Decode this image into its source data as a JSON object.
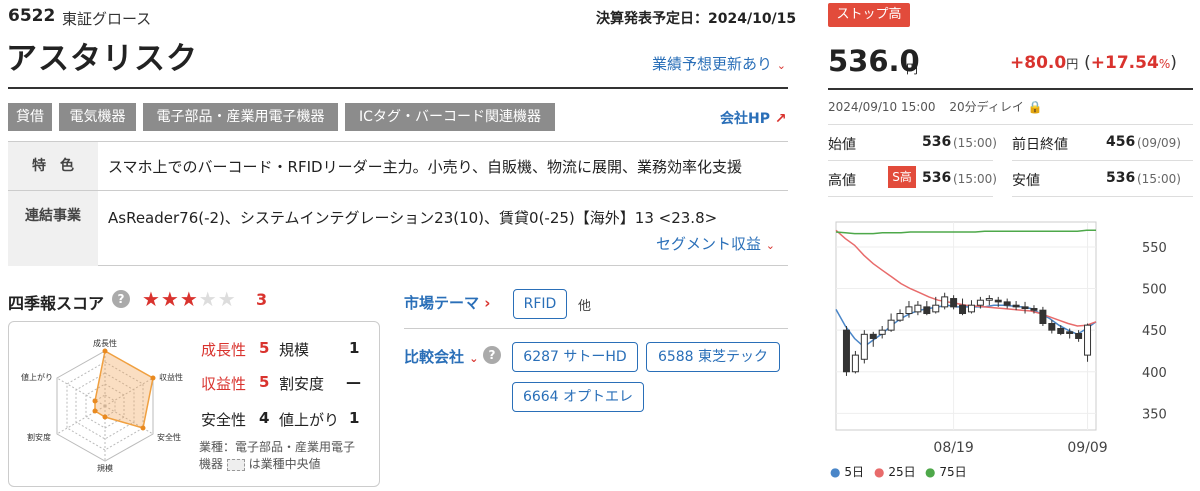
{
  "header": {
    "code": "6522",
    "market": "東証グロース",
    "earnings_date": "決算発表予定日：2024/10/15",
    "name": "アスタリスク",
    "forecast_link": "業績予想更新あり"
  },
  "tags": [
    "貸借",
    "電気機器",
    "電子部品・産業用電子機器",
    "ICタグ・バーコード関連機器"
  ],
  "company_hp": "会社HP",
  "features": {
    "label": "特　色",
    "text": "スマホ上でのバーコード・RFIDリーダー主力。小売り、自販機、物流に展開、業務効率化支援"
  },
  "segments": {
    "label": "連結事業",
    "text": "AsReader76(-2)、システムインテグレーション23(10)、賃貸0(-25)【海外】13 <23.8>",
    "link": "セグメント収益"
  },
  "score": {
    "title": "四季報スコア",
    "help": "?",
    "stars_filled": "★★★",
    "stars_empty": "★★",
    "value": "3",
    "radar_labels": {
      "growth": "成長性",
      "profit": "収益性",
      "safety": "安全性",
      "scale": "規模",
      "cheap": "割安度",
      "rise": "値上がり"
    },
    "items": [
      {
        "label": "成長性",
        "value": "5"
      },
      {
        "label": "規模",
        "value": "1"
      },
      {
        "label": "収益性",
        "value": "5"
      },
      {
        "label": "割安度",
        "value": "—"
      },
      {
        "label": "安全性",
        "value": "4"
      },
      {
        "label": "値上がり",
        "value": "1"
      }
    ],
    "note_line1": "業種：電子部品・産業用電子",
    "note_line2": "機器",
    "note_line3": "は業種中央値"
  },
  "market_theme": {
    "label": "市場テーマ",
    "chip": "RFID",
    "other": "他"
  },
  "compare": {
    "label": "比較会社",
    "help": "?",
    "companies": [
      "6287 サトーHD",
      "6588 東芝テック",
      "6664 オプトエレ"
    ]
  },
  "quote": {
    "badge": "ストップ高",
    "price": "536.0",
    "yen": "円",
    "change": "+80.0",
    "change_unit": "円",
    "change_pct": "+17.54",
    "pct_unit": "%",
    "datetime": "2024/09/10 15:00",
    "delay": "20分ディレイ",
    "open_label": "始値",
    "open": "536",
    "open_time": "(15:00)",
    "prev_label": "前日終値",
    "prev": "456",
    "prev_time": "(09/09)",
    "high_label": "高値",
    "high_badge": "S高",
    "high": "536",
    "high_time": "(15:00)",
    "low_label": "安値",
    "low": "536",
    "low_time": "(15:00)"
  },
  "chart_data": {
    "type": "line",
    "x_ticks": [
      "08/19",
      "09/09"
    ],
    "y_ticks": [
      350,
      400,
      450,
      500,
      550
    ],
    "ylim": [
      330,
      580
    ],
    "candles": [
      {
        "o": 450,
        "c": 400,
        "h": 455,
        "l": 395
      },
      {
        "o": 400,
        "c": 420,
        "h": 425,
        "l": 398
      },
      {
        "o": 415,
        "c": 445,
        "h": 450,
        "l": 410
      },
      {
        "o": 445,
        "c": 440,
        "h": 448,
        "l": 430
      },
      {
        "o": 445,
        "c": 450,
        "h": 455,
        "l": 440
      },
      {
        "o": 450,
        "c": 462,
        "h": 470,
        "l": 448
      },
      {
        "o": 462,
        "c": 470,
        "h": 475,
        "l": 460
      },
      {
        "o": 470,
        "c": 478,
        "h": 485,
        "l": 465
      },
      {
        "o": 472,
        "c": 480,
        "h": 485,
        "l": 468
      },
      {
        "o": 478,
        "c": 470,
        "h": 485,
        "l": 468
      },
      {
        "o": 472,
        "c": 480,
        "h": 490,
        "l": 470
      },
      {
        "o": 478,
        "c": 490,
        "h": 495,
        "l": 475
      },
      {
        "o": 488,
        "c": 478,
        "h": 492,
        "l": 475
      },
      {
        "o": 480,
        "c": 470,
        "h": 488,
        "l": 468
      },
      {
        "o": 472,
        "c": 480,
        "h": 486,
        "l": 470
      },
      {
        "o": 480,
        "c": 486,
        "h": 490,
        "l": 476
      },
      {
        "o": 486,
        "c": 488,
        "h": 492,
        "l": 480
      },
      {
        "o": 486,
        "c": 484,
        "h": 490,
        "l": 478
      },
      {
        "o": 484,
        "c": 480,
        "h": 488,
        "l": 476
      },
      {
        "o": 480,
        "c": 478,
        "h": 485,
        "l": 474
      },
      {
        "o": 478,
        "c": 476,
        "h": 484,
        "l": 470
      },
      {
        "o": 476,
        "c": 474,
        "h": 480,
        "l": 470
      },
      {
        "o": 474,
        "c": 458,
        "h": 478,
        "l": 455
      },
      {
        "o": 458,
        "c": 450,
        "h": 462,
        "l": 446
      },
      {
        "o": 452,
        "c": 446,
        "h": 456,
        "l": 444
      },
      {
        "o": 448,
        "c": 446,
        "h": 452,
        "l": 440
      },
      {
        "o": 446,
        "c": 440,
        "h": 450,
        "l": 436
      },
      {
        "o": 420,
        "c": 456,
        "h": 458,
        "l": 412
      }
    ],
    "series": [
      {
        "name": "5日",
        "color": "#4a86c8",
        "values": [
          475,
          455,
          440,
          430,
          438,
          446,
          456,
          464,
          470,
          474,
          476,
          478,
          480,
          478,
          478,
          478,
          478,
          480,
          480,
          479,
          478,
          476,
          470,
          464,
          456,
          450,
          445,
          452,
          460
        ]
      },
      {
        "name": "25日",
        "color": "#e86b6b",
        "values": [
          570,
          560,
          552,
          540,
          530,
          522,
          514,
          506,
          500,
          495,
          490,
          486,
          484,
          482,
          480,
          479,
          478,
          477,
          476,
          475,
          474,
          473,
          470,
          466,
          462,
          458,
          455,
          456,
          460
        ]
      },
      {
        "name": "75日",
        "color": "#4ea84a",
        "values": [
          568,
          567,
          566,
          566,
          566,
          567,
          567,
          567,
          568,
          568,
          568,
          568,
          568,
          568,
          568,
          568,
          569,
          569,
          569,
          569,
          569,
          569,
          569,
          569,
          569,
          569,
          569,
          570,
          570
        ]
      }
    ]
  }
}
